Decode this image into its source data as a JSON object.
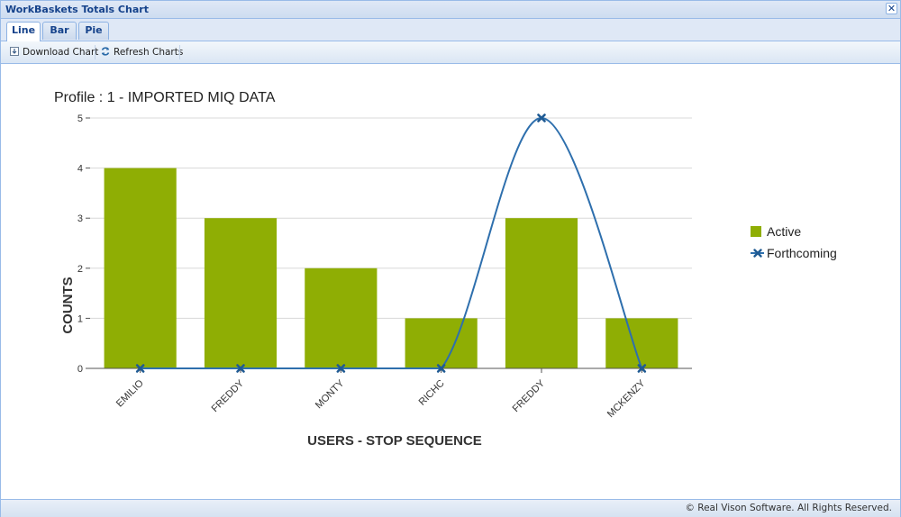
{
  "window": {
    "title": "WorkBaskets Totals Chart",
    "close_glyph": "✕"
  },
  "tabs": [
    {
      "label": "Line",
      "active": true
    },
    {
      "label": "Bar",
      "active": false
    },
    {
      "label": "Pie",
      "active": false
    }
  ],
  "toolbar": {
    "download_label": "Download Chart",
    "refresh_label": "Refresh Charts"
  },
  "icons": {
    "download": "download-icon",
    "refresh": "refresh-icon",
    "close": "close-icon"
  },
  "footer": {
    "copyright": "© Real Vison Software. All Rights Reserved."
  },
  "colors": {
    "active_bar": "#8fae04",
    "forthcoming_line": "#2e6fad",
    "header_blue": "#15428b",
    "border_blue": "#99bbe8"
  },
  "chart_data": {
    "type": "bar",
    "title": "Profile : 1 - IMPORTED MIQ DATA",
    "xlabel": "USERS - STOP SEQUENCE",
    "ylabel": "COUNTS",
    "categories": [
      "EMILIO",
      "FREDDY",
      "MONTY",
      "RICHC",
      "FREDDY",
      "MCKENZY"
    ],
    "ylim": [
      0,
      5
    ],
    "yticks": [
      "0",
      "1",
      "2",
      "3",
      "4",
      "5"
    ],
    "grid": true,
    "legend_position": "right",
    "series": [
      {
        "name": "Active",
        "type": "bar",
        "values": [
          4,
          3,
          2,
          1,
          3,
          1
        ]
      },
      {
        "name": "Forthcoming",
        "type": "line",
        "values": [
          0,
          0,
          0,
          0,
          5,
          0
        ]
      }
    ]
  }
}
